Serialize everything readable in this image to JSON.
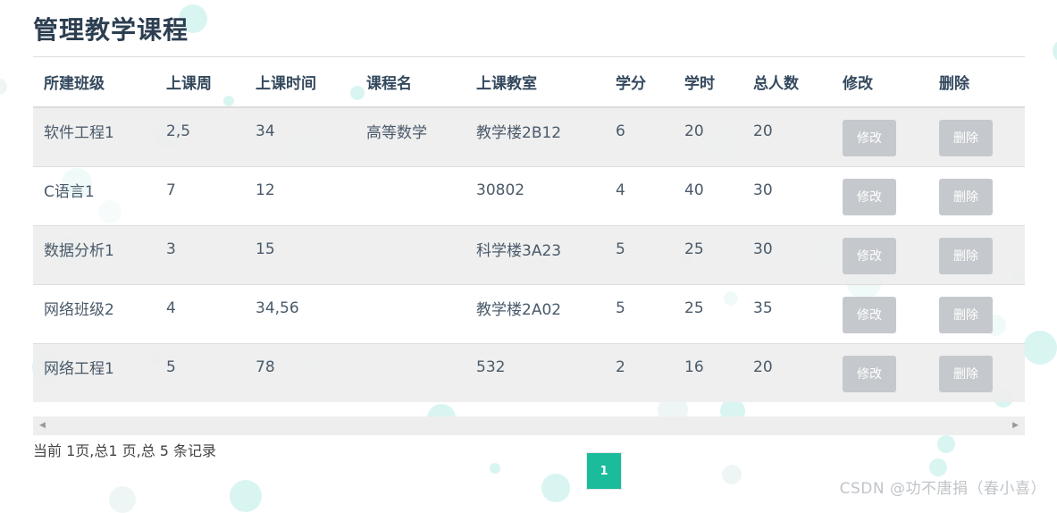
{
  "page": {
    "title": "管理教学课程"
  },
  "table": {
    "headers": [
      "所建班级",
      "上课周",
      "上课时间",
      "课程名",
      "上课教室",
      "学分",
      "学时",
      "总人数",
      "修改",
      "删除"
    ],
    "rows": [
      {
        "class_name": "软件工程1",
        "weeks": "2,5",
        "time": "34",
        "course": "高等数学",
        "room": "教学楼2B12",
        "credit": "6",
        "hours": "20",
        "total": "20",
        "edit_label": "修改",
        "delete_label": "删除"
      },
      {
        "class_name": "C语言1",
        "weeks": "7",
        "time": "12",
        "course": "",
        "room": "30802",
        "credit": "4",
        "hours": "40",
        "total": "30",
        "edit_label": "修改",
        "delete_label": "删除"
      },
      {
        "class_name": "数据分析1",
        "weeks": "3",
        "time": "15",
        "course": "",
        "room": "科学楼3A23",
        "credit": "5",
        "hours": "25",
        "total": "30",
        "edit_label": "修改",
        "delete_label": "删除"
      },
      {
        "class_name": "网络班级2",
        "weeks": "4",
        "time": "34,56",
        "course": "",
        "room": "教学楼2A02",
        "credit": "5",
        "hours": "25",
        "total": "35",
        "edit_label": "修改",
        "delete_label": "删除"
      },
      {
        "class_name": "网络工程1",
        "weeks": "5",
        "time": "78",
        "course": "",
        "room": "532",
        "credit": "2",
        "hours": "16",
        "total": "20",
        "edit_label": "修改",
        "delete_label": "删除"
      }
    ]
  },
  "scrollbar": {
    "left_icon": "triangle-left-icon",
    "right_icon": "triangle-right-icon"
  },
  "pagination": {
    "info": "当前 1页,总1 页,总 5 条记录",
    "current_page": "1"
  },
  "watermark": "CSDN @功不唐捐（春小喜）",
  "colors": {
    "accent": "#1abc9c",
    "button_gray": "#c5c9cd",
    "title": "#2c3e50"
  }
}
